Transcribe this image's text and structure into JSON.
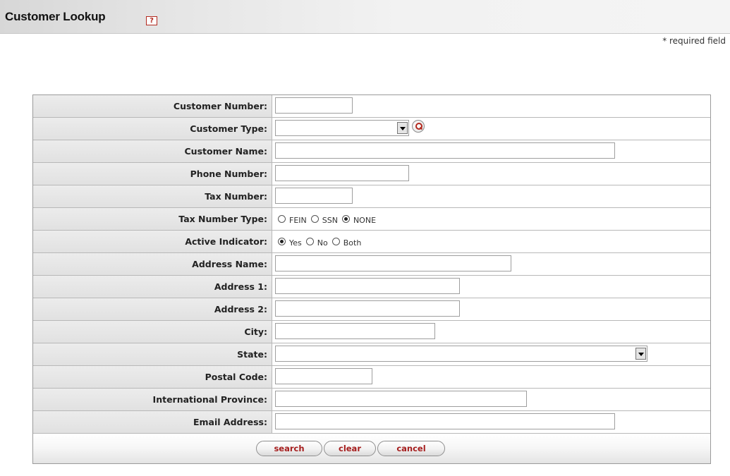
{
  "page": {
    "title": "Customer Lookup",
    "help_glyph": "?",
    "required_note": "* required field"
  },
  "fields": [
    {
      "label": "Customer Number:",
      "type": "text",
      "value": ""
    },
    {
      "label": "Customer Type:",
      "type": "select",
      "value": "",
      "icon": "lookup-icon"
    },
    {
      "label": "Customer Name:",
      "type": "text",
      "value": ""
    },
    {
      "label": "Phone Number:",
      "type": "text",
      "value": ""
    },
    {
      "label": "Tax Number:",
      "type": "text",
      "value": ""
    },
    {
      "label": "Tax Number Type:",
      "type": "radio",
      "options": [
        "FEIN",
        "SSN",
        "NONE"
      ],
      "selected": "NONE"
    },
    {
      "label": "Active Indicator:",
      "type": "radio",
      "options": [
        "Yes",
        "No",
        "Both"
      ],
      "selected": "Yes"
    },
    {
      "label": "Address Name:",
      "type": "text",
      "value": ""
    },
    {
      "label": "Address 1:",
      "type": "text",
      "value": ""
    },
    {
      "label": "Address 2:",
      "type": "text",
      "value": ""
    },
    {
      "label": "City:",
      "type": "text",
      "value": ""
    },
    {
      "label": "State:",
      "type": "select",
      "value": ""
    },
    {
      "label": "Postal Code:",
      "type": "text",
      "value": ""
    },
    {
      "label": "International Province:",
      "type": "text",
      "value": ""
    },
    {
      "label": "Email Address:",
      "type": "text",
      "value": ""
    }
  ],
  "buttons": {
    "search": "search",
    "clear": "clear",
    "cancel": "cancel"
  },
  "colors": {
    "accent": "#a51d1d",
    "label_background": "#e6e6e6",
    "border": "#b8b8b8"
  }
}
